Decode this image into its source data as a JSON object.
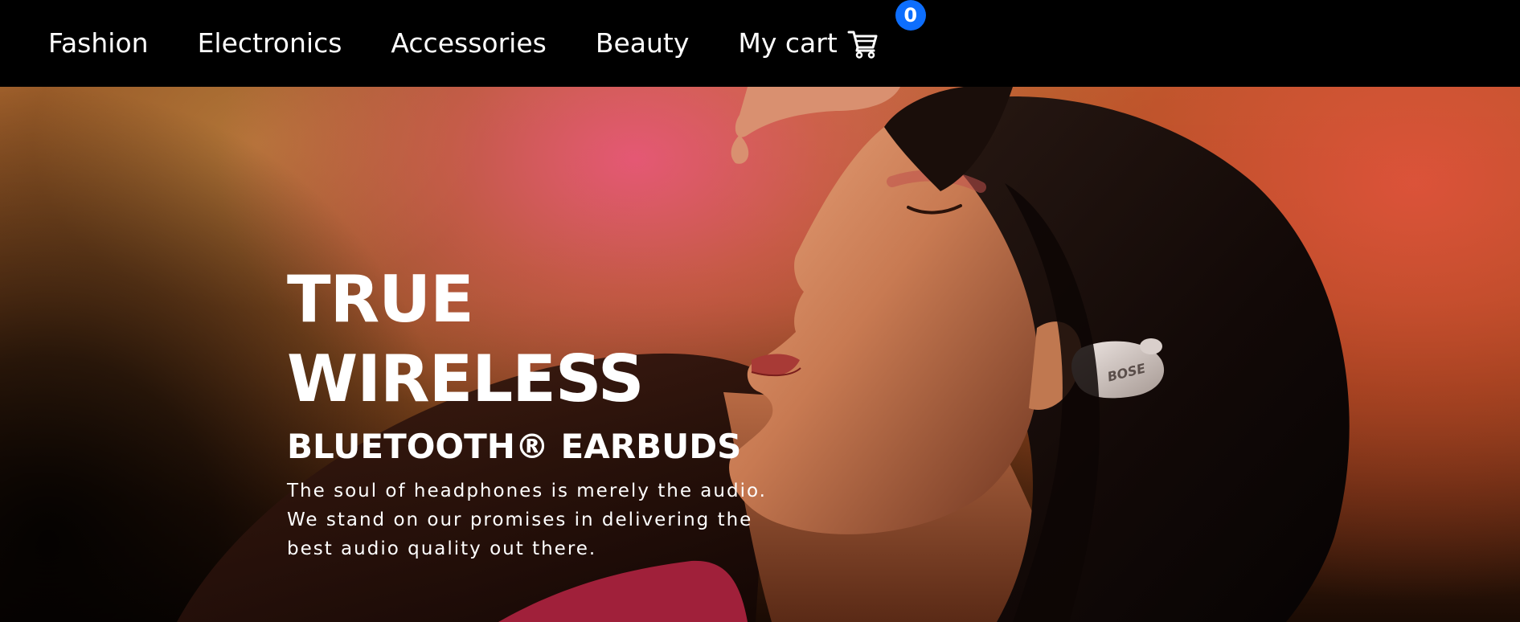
{
  "nav": {
    "items": [
      {
        "label": "Fashion"
      },
      {
        "label": "Electronics"
      },
      {
        "label": "Accessories"
      },
      {
        "label": "Beauty"
      }
    ],
    "cart": {
      "label": "My cart",
      "icon": "cart-icon",
      "count": "0",
      "badge_color": "#0d6efd"
    }
  },
  "hero": {
    "heading_line1": "TRUE",
    "heading_line2": "WIRELESS",
    "subheading": "BLUETOOTH® EARBUDS",
    "description_line1": "The soul of headphones is merely the audio.",
    "description_line2": "We stand on our promises in delivering the",
    "description_line3": "best audio quality out there.",
    "earbud_logo": "BOSE"
  },
  "colors": {
    "nav_bg": "#000000",
    "text": "#ffffff",
    "accent": "#0d6efd"
  }
}
